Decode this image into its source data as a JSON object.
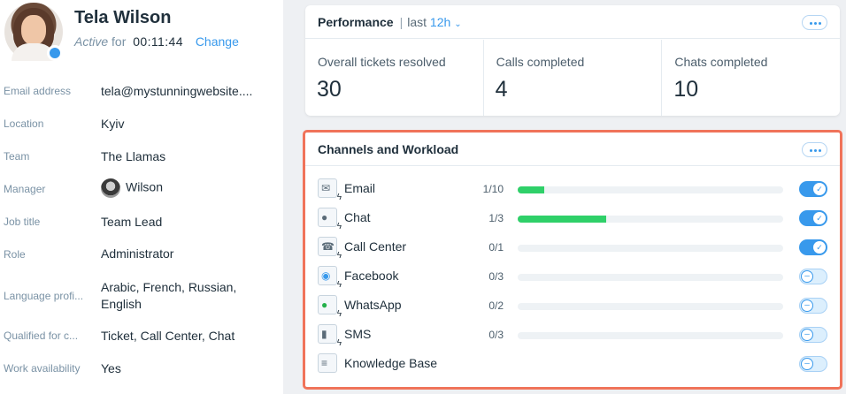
{
  "profile": {
    "name": "Tela Wilson",
    "status_prefix": "Active",
    "status_for": "for",
    "timer": "00:11:44",
    "change_label": "Change",
    "status_color": "#3899ec"
  },
  "fields": [
    {
      "label": "Email address",
      "value": "tela@mystunningwebsite...."
    },
    {
      "label": "Location",
      "value": "Kyiv"
    },
    {
      "label": "Team",
      "value": "The Llamas"
    },
    {
      "label": "Manager",
      "value": "Wilson"
    },
    {
      "label": "Job title",
      "value": "Team Lead"
    },
    {
      "label": "Role",
      "value": "Administrator"
    },
    {
      "label": "Language profi...",
      "value": "Arabic, French, Russian, English"
    },
    {
      "label": "Qualified for c...",
      "value": "Ticket, Call Center, Chat"
    },
    {
      "label": "Work availability",
      "value": "Yes"
    }
  ],
  "performance": {
    "title": "Performance",
    "range_prefix": "last",
    "range_value": "12h",
    "metrics": [
      {
        "label": "Overall tickets resolved",
        "value": "30"
      },
      {
        "label": "Calls completed",
        "value": "4"
      },
      {
        "label": "Chats completed",
        "value": "10"
      }
    ]
  },
  "channels": {
    "title": "Channels and Workload",
    "accent": "#3899ec",
    "fill_color": "#2fd069",
    "highlight_color": "#f0735a",
    "items": [
      {
        "name": "Email",
        "icon": "email-icon",
        "count": "1/10",
        "load": 0.1,
        "enabled": true
      },
      {
        "name": "Chat",
        "icon": "chat-icon",
        "count": "1/3",
        "load": 0.333,
        "enabled": true
      },
      {
        "name": "Call Center",
        "icon": "phone-icon",
        "count": "0/1",
        "load": 0,
        "enabled": true
      },
      {
        "name": "Facebook",
        "icon": "messenger-icon",
        "count": "0/3",
        "load": 0,
        "enabled": false
      },
      {
        "name": "WhatsApp",
        "icon": "whatsapp-icon",
        "count": "0/2",
        "load": 0,
        "enabled": false
      },
      {
        "name": "SMS",
        "icon": "sms-icon",
        "count": "0/3",
        "load": 0,
        "enabled": false
      },
      {
        "name": "Knowledge Base",
        "icon": "knowledge-base-icon",
        "count": "",
        "load": null,
        "enabled": false
      }
    ]
  }
}
